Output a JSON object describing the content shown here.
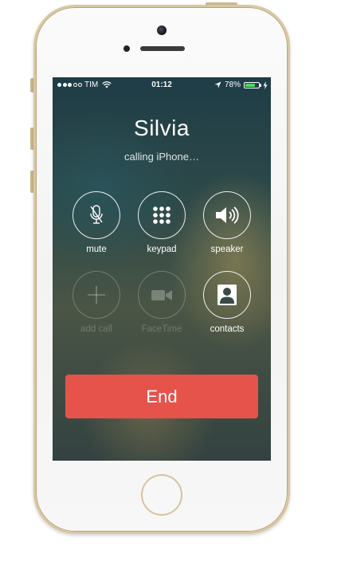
{
  "status_bar": {
    "carrier": "TIM",
    "time": "01:12",
    "battery_percent": "78%",
    "battery_level": 0.78,
    "signal_bars_filled": 3,
    "signal_bars_total": 5
  },
  "call": {
    "caller_name": "Silvia",
    "status_text": "calling iPhone…"
  },
  "actions": {
    "mute": {
      "label": "mute",
      "icon": "muted-mic-icon",
      "enabled": true
    },
    "keypad": {
      "label": "keypad",
      "icon": "keypad-icon",
      "enabled": true
    },
    "speaker": {
      "label": "speaker",
      "icon": "speaker-icon",
      "enabled": true
    },
    "add_call": {
      "label": "add call",
      "icon": "plus-icon",
      "enabled": false
    },
    "facetime": {
      "label": "FaceTime",
      "icon": "video-camera-icon",
      "enabled": false
    },
    "contacts": {
      "label": "contacts",
      "icon": "contact-person-icon",
      "enabled": true
    }
  },
  "end_button": {
    "label": "End"
  },
  "colors": {
    "end_red": "#e5534b",
    "battery_green": "#4cd964",
    "phone_trim_gold": "#d9c7a3"
  }
}
